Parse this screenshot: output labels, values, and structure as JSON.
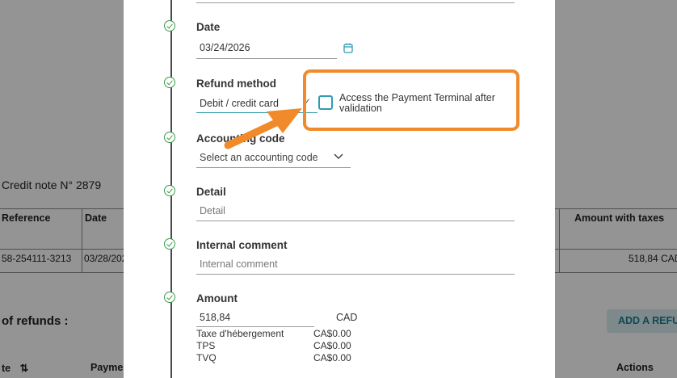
{
  "background": {
    "credit_note_title": "Credit note N° 2879",
    "table": {
      "headers": [
        "Reference",
        "Date",
        "Amount with taxes"
      ],
      "row": {
        "reference": "58-254111-3213",
        "date": "03/28/202",
        "amount": "518,84 CAD"
      }
    },
    "refunds_title": "of refunds :",
    "add_refund_label": "ADD A REFU",
    "bottom_headers": {
      "sort_col": "te",
      "payment": "Payme",
      "actions": "Actions"
    }
  },
  "form": {
    "date": {
      "label": "Date",
      "value": "03/24/2026"
    },
    "refund_method": {
      "label": "Refund method",
      "value": "Debit / credit card"
    },
    "payment_terminal": {
      "label": "Access the Payment Terminal after validation",
      "checked": false
    },
    "accounting_code": {
      "label": "Accounting code",
      "placeholder": "Select an accounting code"
    },
    "detail": {
      "label": "Detail",
      "placeholder": "Detail"
    },
    "internal_comment": {
      "label": "Internal comment",
      "placeholder": "Internal comment"
    },
    "amount": {
      "label": "Amount",
      "value": "518,84",
      "currency": "CAD",
      "taxes": [
        {
          "name": "Taxe d'hébergement",
          "value": "CA$0.00"
        },
        {
          "name": "TPS",
          "value": "CA$0.00"
        },
        {
          "name": "TVQ",
          "value": "CA$0.00"
        }
      ]
    }
  },
  "colors": {
    "highlight": "#f08a2a",
    "check": "#3a9b49",
    "checkbox": "#2f9cb0",
    "calendar": "#2f9cb0"
  }
}
